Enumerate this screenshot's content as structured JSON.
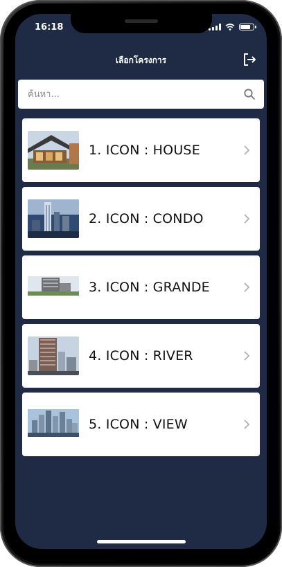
{
  "status_bar": {
    "time": "16:18"
  },
  "header": {
    "title": "เลือกโครงการ",
    "logout_icon": "logout-icon"
  },
  "search": {
    "placeholder": "ค้นหา...",
    "value": "",
    "icon": "search-icon"
  },
  "projects": [
    {
      "label": "1. ICON : HOUSE",
      "icon": "chevron-right-icon"
    },
    {
      "label": "2. ICON : CONDO",
      "icon": "chevron-right-icon"
    },
    {
      "label": "3. ICON : GRANDE",
      "icon": "chevron-right-icon"
    },
    {
      "label": "4. ICON : RIVER",
      "icon": "chevron-right-icon"
    },
    {
      "label": "5. ICON : VIEW",
      "icon": "chevron-right-icon"
    }
  ],
  "colors": {
    "background": "#1f2a44",
    "card": "#ffffff",
    "text": "#111111",
    "chevron": "#b0b0b0"
  }
}
